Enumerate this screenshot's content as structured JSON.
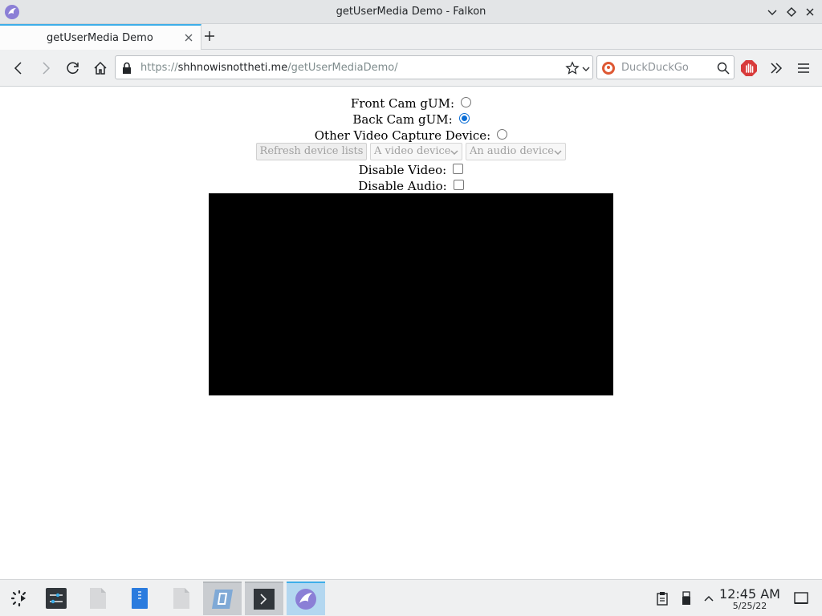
{
  "window": {
    "title": "getUserMedia Demo - Falkon",
    "app_icon": "falkon-icon",
    "controls": [
      "minimize-icon",
      "maximize-icon",
      "close-icon"
    ]
  },
  "tabs": [
    {
      "label": "getUserMedia Demo",
      "active": true
    }
  ],
  "navbar": {
    "url_scheme": "https://",
    "url_host": "shhnowisnottheti.me",
    "url_path": "/getUserMediaDemo/",
    "search_placeholder": "DuckDuckGo",
    "search_engine_icon": "duckduckgo-icon"
  },
  "page": {
    "front_cam_label": "Front Cam gUM:",
    "front_cam_checked": false,
    "back_cam_label": "Back Cam gUM:",
    "back_cam_checked": true,
    "other_device_label": "Other Video Capture Device:",
    "other_device_checked": false,
    "refresh_button_label": "Refresh device lists",
    "video_device_select": "A video device",
    "audio_device_select": "An audio device",
    "disable_video_label": "Disable Video:",
    "disable_video_checked": false,
    "disable_audio_label": "Disable Audio:",
    "disable_audio_checked": false
  },
  "taskbar": {
    "time": "12:45 AM",
    "date": "5/25/22"
  },
  "colors": {
    "accent": "#3daee9",
    "radio_checked": "#0b6ed6",
    "video_background": "#000000"
  }
}
